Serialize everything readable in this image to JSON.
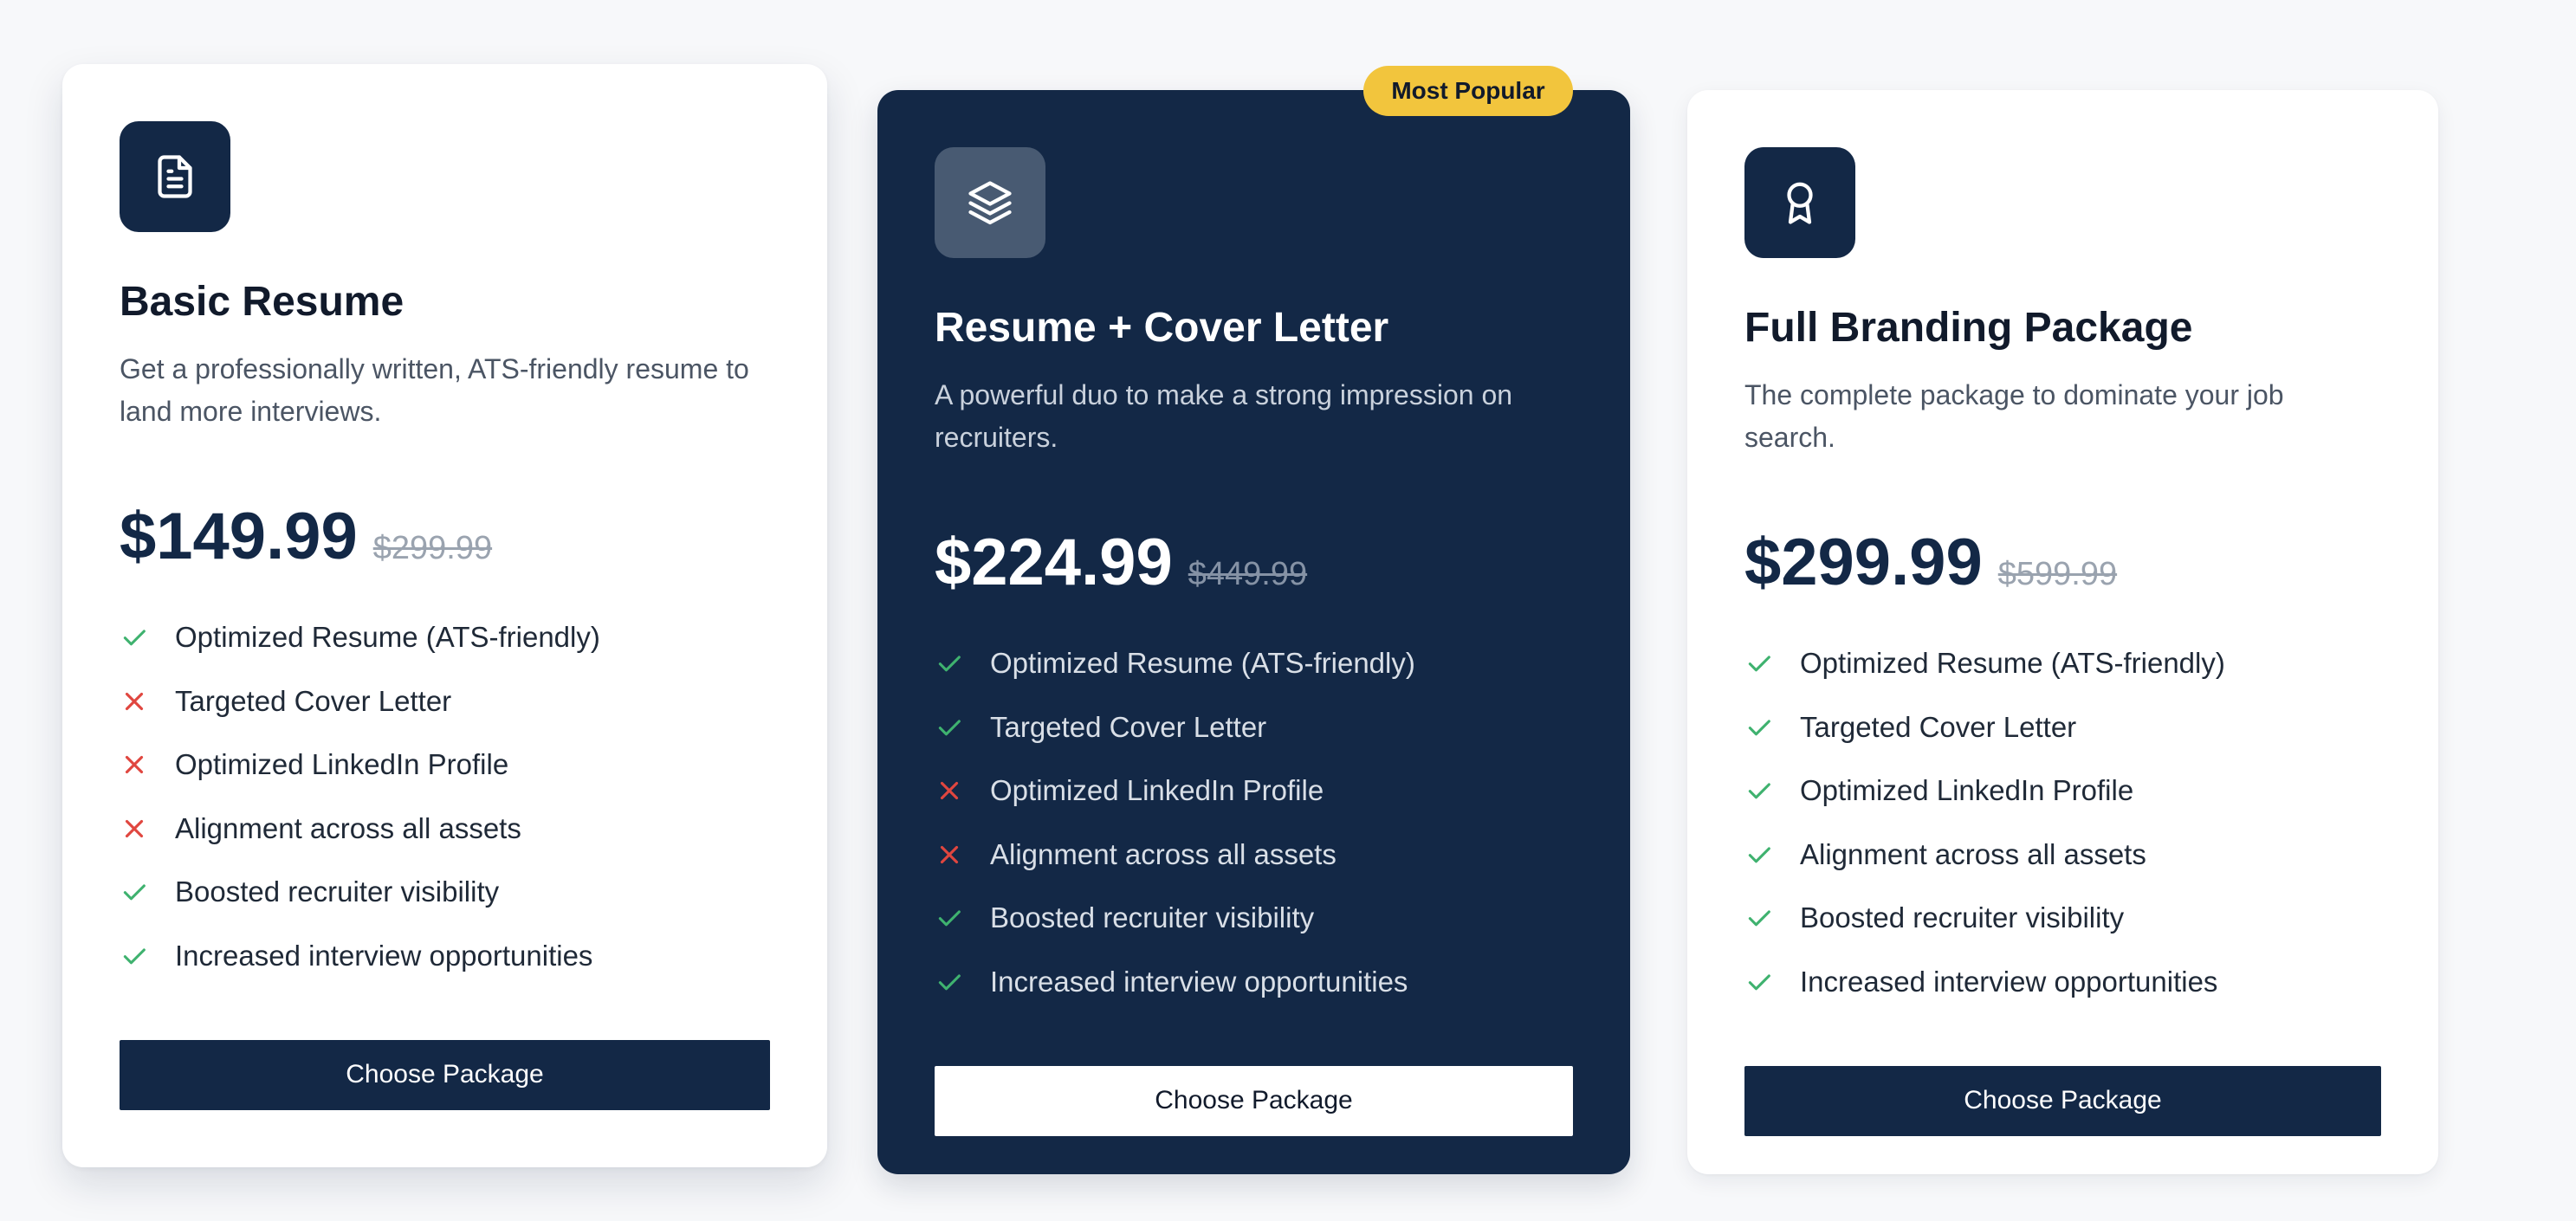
{
  "colors": {
    "navy": "#132846",
    "check_green": "#3fb26f",
    "cross_red": "#e0463f",
    "badge_yellow": "#f2c53d",
    "page_background": "#f7f8fa"
  },
  "plans": [
    {
      "icon": "document-icon",
      "title": "Basic Resume",
      "description": "Get a professionally written, ATS-friendly resume to land more interviews.",
      "price": "$149.99",
      "original_price": "$299.99",
      "features": [
        {
          "label": "Optimized Resume (ATS-friendly)",
          "included": true
        },
        {
          "label": "Targeted Cover Letter",
          "included": false
        },
        {
          "label": "Optimized LinkedIn Profile",
          "included": false
        },
        {
          "label": "Alignment across all assets",
          "included": false
        },
        {
          "label": "Boosted recruiter visibility",
          "included": true
        },
        {
          "label": "Increased interview opportunities",
          "included": true
        }
      ],
      "button_label": "Choose Package"
    },
    {
      "icon": "layers-icon",
      "badge": "Most Popular",
      "title": "Resume + Cover Letter",
      "description": "A powerful duo to make a strong impression on recruiters.",
      "price": "$224.99",
      "original_price": "$449.99",
      "features": [
        {
          "label": "Optimized Resume (ATS-friendly)",
          "included": true
        },
        {
          "label": "Targeted Cover Letter",
          "included": true
        },
        {
          "label": "Optimized LinkedIn Profile",
          "included": false
        },
        {
          "label": "Alignment across all assets",
          "included": false
        },
        {
          "label": "Boosted recruiter visibility",
          "included": true
        },
        {
          "label": "Increased interview opportunities",
          "included": true
        }
      ],
      "button_label": "Choose Package"
    },
    {
      "icon": "award-icon",
      "title": "Full Branding Package",
      "description": "The complete package to dominate your job search.",
      "price": "$299.99",
      "original_price": "$599.99",
      "features": [
        {
          "label": "Optimized Resume (ATS-friendly)",
          "included": true
        },
        {
          "label": "Targeted Cover Letter",
          "included": true
        },
        {
          "label": "Optimized LinkedIn Profile",
          "included": true
        },
        {
          "label": "Alignment across all assets",
          "included": true
        },
        {
          "label": "Boosted recruiter visibility",
          "included": true
        },
        {
          "label": "Increased interview opportunities",
          "included": true
        }
      ],
      "button_label": "Choose Package"
    }
  ]
}
